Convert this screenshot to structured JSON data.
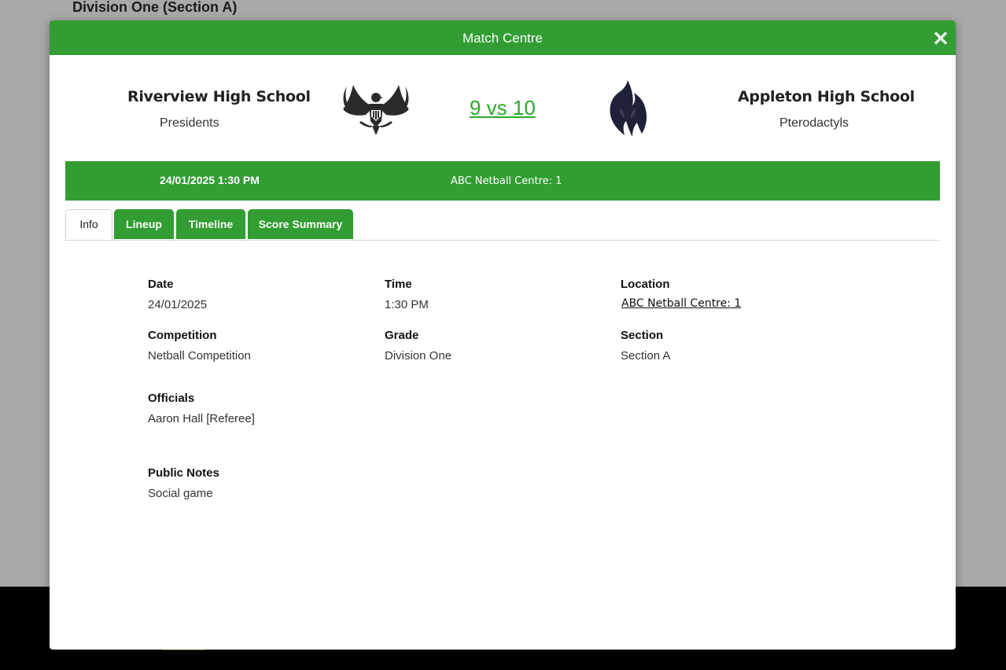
{
  "page": {
    "heading": "Division One (Section A)"
  },
  "modal": {
    "title": "Match Centre",
    "close_icon": "close-icon"
  },
  "home_team": {
    "name": "Riverview High School",
    "nickname": "Presidents",
    "logo_icon": "eagle-icon"
  },
  "away_team": {
    "name": "Appleton High School",
    "nickname": "Pterodactyls",
    "logo_icon": "pterodactyl-icon"
  },
  "score": {
    "text": "9 vs 10"
  },
  "info_bar": {
    "datetime": "24/01/2025 1:30 PM",
    "venue": "ABC Netball Centre: 1"
  },
  "tabs": [
    {
      "label": "Info",
      "active": true
    },
    {
      "label": "Lineup",
      "active": false
    },
    {
      "label": "Timeline",
      "active": false
    },
    {
      "label": "Score Summary",
      "active": false
    }
  ],
  "details": {
    "date": {
      "label": "Date",
      "value": "24/01/2025"
    },
    "time": {
      "label": "Time",
      "value": "1:30 PM"
    },
    "location": {
      "label": "Location",
      "value": "ABC Netball Centre: 1"
    },
    "competition": {
      "label": "Competition",
      "value": "Netball Competition"
    },
    "grade": {
      "label": "Grade",
      "value": "Division One"
    },
    "section": {
      "label": "Section",
      "value": "Section A"
    },
    "officials": {
      "label": "Officials",
      "value": "Aaron Hall [Referee]"
    },
    "public_notes": {
      "label": "Public Notes",
      "value": "Social game"
    }
  },
  "colors": {
    "brand_green": "#319d32",
    "score_green": "#2aa82a",
    "overlay": "#a9a9a9"
  }
}
